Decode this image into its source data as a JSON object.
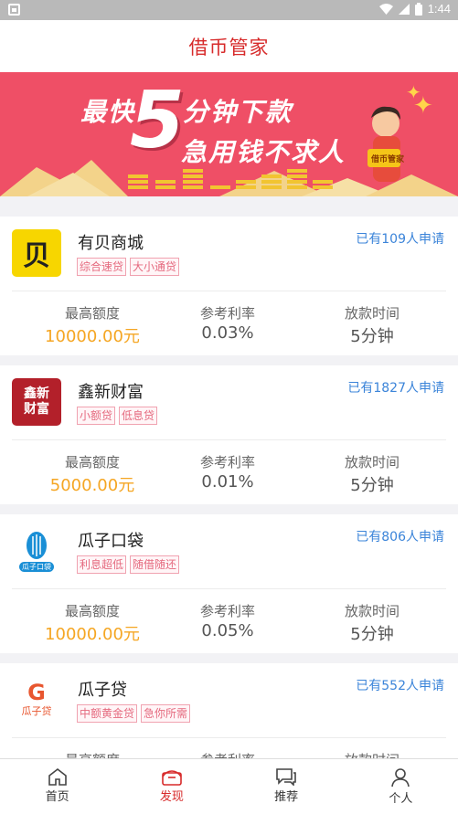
{
  "status_bar": {
    "time": "1:44",
    "battery_icon": "battery-icon",
    "wifi_icon": "wifi-icon",
    "signal_icon": "signal-icon"
  },
  "header": {
    "title": "借币管家"
  },
  "banner": {
    "line1": "最快",
    "big_number": "5",
    "line1_rest": "分钟下款",
    "line2": "急用钱不求人",
    "badge": "借币管家"
  },
  "labels": {
    "max_amount": "最高额度",
    "rate": "参考利率",
    "time": "放款时间"
  },
  "loans": [
    {
      "name": "有贝商城",
      "applied": "已有109人申请",
      "tags": [
        "综合速贷",
        "大小通贷"
      ],
      "amount": "10000.00元",
      "rate": "0.03%",
      "time": "5分钟",
      "logo_text": "贝",
      "logo_bg": "#f7d600",
      "logo_fg": "#222222"
    },
    {
      "name": "鑫新财富",
      "applied": "已有1827人申请",
      "tags": [
        "小额贷",
        "低息贷"
      ],
      "amount": "5000.00元",
      "rate": "0.01%",
      "time": "5分钟",
      "logo_text": "鑫新\n财富",
      "logo_bg": "#b3202a",
      "logo_fg": "#ffffff"
    },
    {
      "name": "瓜子口袋",
      "applied": "已有806人申请",
      "tags": [
        "利息超低",
        "随借随还"
      ],
      "amount": "10000.00元",
      "rate": "0.05%",
      "time": "5分钟",
      "logo_text": "瓜子口袋",
      "logo_bg": "#ffffff",
      "logo_fg": "#1a8fd6"
    },
    {
      "name": "瓜子贷",
      "applied": "已有552人申请",
      "tags": [
        "中额黄金贷",
        "急你所需"
      ],
      "amount": "",
      "rate": "",
      "time": "",
      "logo_text": "瓜子贷",
      "logo_bg": "#ffffff",
      "logo_fg": "#e8562f"
    }
  ],
  "tabs": [
    {
      "label": "首页",
      "icon": "home-icon",
      "active": false
    },
    {
      "label": "发现",
      "icon": "discover-icon",
      "active": true
    },
    {
      "label": "推荐",
      "icon": "chat-icon",
      "active": false
    },
    {
      "label": "个人",
      "icon": "person-icon",
      "active": false
    }
  ],
  "colors": {
    "brand_red": "#d72a2a",
    "banner_bg": "#ef4f66",
    "link_blue": "#3b84d9",
    "amount_orange": "#f5a623"
  }
}
